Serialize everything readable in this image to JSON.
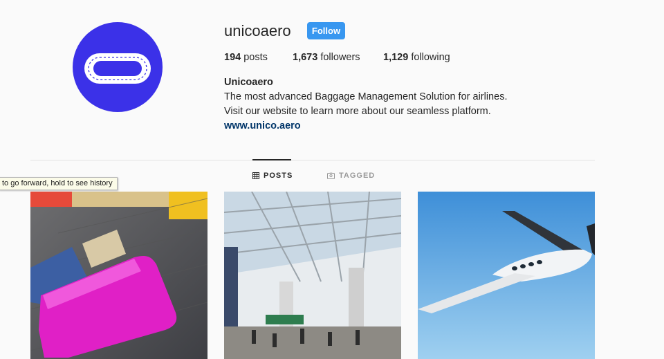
{
  "profile": {
    "username": "unicoaero",
    "follow_label": "Follow",
    "posts_count": "194",
    "posts_label": "posts",
    "followers_count": "1,673",
    "followers_label": "followers",
    "following_count": "1,129",
    "following_label": "following",
    "full_name": "Unicoaero",
    "bio_line1": "The most advanced Baggage Management Solution for airlines.",
    "bio_line2": "Visit our website to learn more about our seamless platform.",
    "website": "www.unico.aero"
  },
  "tabs": [
    {
      "label": "POSTS",
      "icon": "grid-icon",
      "active": true
    },
    {
      "label": "TAGGED",
      "icon": "tag-icon",
      "active": false
    }
  ],
  "tooltip": "to go forward, hold to see history",
  "posts": [
    {
      "subject": "pink suitcase on baggage carousel"
    },
    {
      "subject": "airport terminal interior"
    },
    {
      "subject": "electric airplane in flight"
    }
  ],
  "colors": {
    "avatar_bg": "#3b31e8",
    "follow_button": "#3897f0",
    "link": "#003569"
  }
}
